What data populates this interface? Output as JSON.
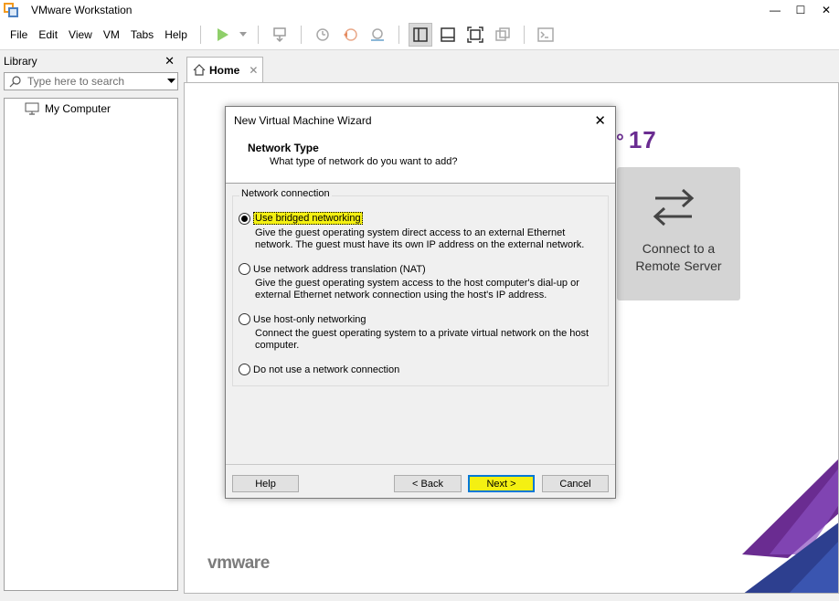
{
  "window": {
    "title": "VMware Workstation",
    "controls": [
      "—",
      "☐",
      "✕"
    ]
  },
  "menu": [
    "File",
    "Edit",
    "View",
    "VM",
    "Tabs",
    "Help"
  ],
  "library": {
    "title": "Library",
    "search_placeholder": "Type here to search",
    "items": [
      {
        "label": "My Computer",
        "icon": "computer-icon"
      }
    ]
  },
  "tabs": [
    {
      "label": "Home"
    }
  ],
  "home": {
    "version_suffix": "17",
    "connect_line1": "Connect to a",
    "connect_line2": "Remote Server",
    "logo": "vmware"
  },
  "dialog": {
    "title": "New Virtual Machine Wizard",
    "heading": "Network Type",
    "subheading": "What type of network do you want to add?",
    "group_label": "Network connection",
    "options": [
      {
        "label": "Use bridged networking",
        "selected": true,
        "desc1": "Give the guest operating system direct access to an external Ethernet",
        "desc2": "network. The guest must have its own IP address on the external network."
      },
      {
        "label": "Use network address translation (NAT)",
        "selected": false,
        "desc1": "Give the guest operating system access to the host computer's dial-up or",
        "desc2": "external Ethernet network connection using the host's IP address."
      },
      {
        "label": "Use host-only networking",
        "selected": false,
        "desc1": "Connect the guest operating system to a private virtual network on the host",
        "desc2": "computer."
      },
      {
        "label": "Do not use a network connection",
        "selected": false
      }
    ],
    "buttons": {
      "help": "Help",
      "back": "< Back",
      "next": "Next >",
      "cancel": "Cancel"
    }
  },
  "colors": {
    "accent_purple": "#6a2c91",
    "highlight_yellow": "#f4f012",
    "focus_blue": "#0078d7"
  }
}
